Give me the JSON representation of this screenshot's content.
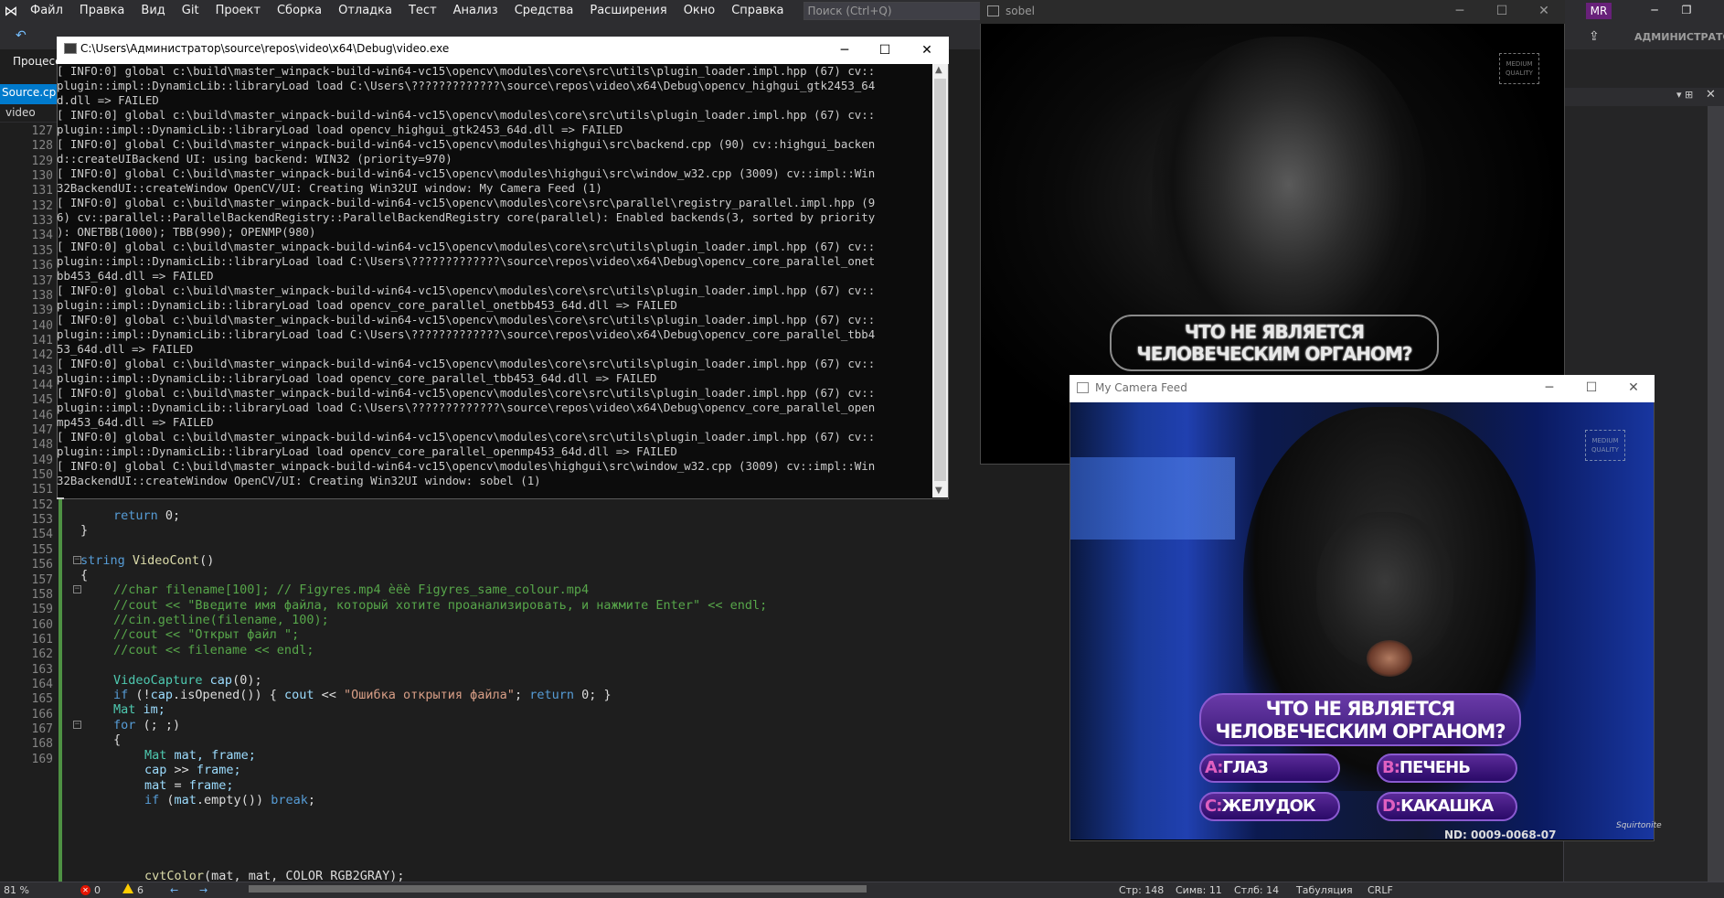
{
  "menubar": {
    "items": [
      "Файл",
      "Правка",
      "Вид",
      "Git",
      "Проект",
      "Сборка",
      "Отладка",
      "Тест",
      "Анализ",
      "Средства",
      "Расширения",
      "Окно",
      "Справка"
    ],
    "search_placeholder": "Поиск (Ctrl+Q)",
    "solution_name": "video",
    "user_initials": "MR",
    "admin_label": "АДМИНИСТРАТОР"
  },
  "toolbar": {
    "process_label": "Процесс"
  },
  "tabs": {
    "source_tab": "Source.cpp",
    "project_label": "video"
  },
  "editor": {
    "lines": [
      {
        "n": "127"
      },
      {
        "n": "128"
      },
      {
        "n": "129"
      },
      {
        "n": "130"
      },
      {
        "n": "131"
      },
      {
        "n": "132"
      },
      {
        "n": "133"
      },
      {
        "n": "134"
      },
      {
        "n": "135"
      },
      {
        "n": "136"
      },
      {
        "n": "137"
      },
      {
        "n": "138"
      },
      {
        "n": "139"
      },
      {
        "n": "140"
      },
      {
        "n": "141"
      },
      {
        "n": "142"
      },
      {
        "n": "143"
      },
      {
        "n": "144"
      },
      {
        "n": "145"
      },
      {
        "n": "146"
      },
      {
        "n": "147"
      },
      {
        "n": "148"
      },
      {
        "n": "149"
      },
      {
        "n": "150"
      },
      {
        "n": "151"
      },
      {
        "n": "152"
      },
      {
        "n": "153"
      },
      {
        "n": "154"
      },
      {
        "n": "155"
      },
      {
        "n": "156"
      },
      {
        "n": "157"
      },
      {
        "n": "158"
      },
      {
        "n": "159"
      },
      {
        "n": "160"
      },
      {
        "n": "161"
      },
      {
        "n": "162"
      },
      {
        "n": "163"
      },
      {
        "n": "164"
      },
      {
        "n": "165"
      },
      {
        "n": "166"
      },
      {
        "n": "167"
      },
      {
        "n": "168"
      },
      {
        "n": "169"
      }
    ],
    "code": {
      "l148_kw": "return",
      "l148_rest": " 0;",
      "l149": "}",
      "l151_type": "string",
      "l151_fn": " VideoCont",
      "l151_rest": "()",
      "l152": "{",
      "l153": "//char filename[100]; // Figyres.mp4 èëè Figyres_same_colour.mp4",
      "l154": "//cout << \"Введите имя файла, который хотите проанализировать, и нажмите Enter\" << endl;",
      "l155": "//cin.getline(filename, 100);",
      "l156": "//cout << \"Открыт файл \";",
      "l157": "//cout << filename << endl;",
      "l159_type": "VideoCapture",
      "l159_rest_a": " cap",
      "l159_rest_b": "(0);",
      "l160_kw": "if",
      "l160_a": " (!",
      "l160_b": "cap",
      "l160_c": ".isOpened()) { ",
      "l160_d": "cout",
      "l160_e": " << ",
      "l160_str": "\"Ошибка открытия файла\"",
      "l160_f": "; ",
      "l160_kw2": "return",
      "l160_g": " 0; }",
      "l161_type": "Mat",
      "l161_rest": " im;",
      "l162_kw": "for",
      "l162_rest": " (; ;)",
      "l163": "{",
      "l164_type": "Mat",
      "l164_rest": " mat, frame;",
      "l165_a": "cap",
      "l165_b": " >> ",
      "l165_c": "frame;",
      "l166_a": "mat",
      "l166_b": " = ",
      "l166_c": "frame;",
      "l167_kw": "if",
      "l167_a": " (",
      "l167_b": "mat",
      "l167_c": ".empty()) ",
      "l167_kw2": "break",
      "l167_d": ";",
      "l169_fn": "cvtColor",
      "l169_rest": "(mat, mat, COLOR_RGB2GRAY);"
    }
  },
  "statusbar": {
    "zoom": "81 %",
    "errors": "0",
    "warnings": "6",
    "row": "Стр: 148",
    "char": "Симв: 11",
    "col": "Стлб: 14",
    "tabs": "Табуляция",
    "eol": "CRLF"
  },
  "console": {
    "title": "C:\\Users\\Администратор\\source\\repos\\video\\x64\\Debug\\video.exe",
    "lines": [
      "[ INFO:0] global c:\\build\\master_winpack-build-win64-vc15\\opencv\\modules\\core\\src\\utils\\plugin_loader.impl.hpp (67) cv::",
      "plugin::impl::DynamicLib::libraryLoad load C:\\Users\\?????????????\\source\\repos\\video\\x64\\Debug\\opencv_highgui_gtk2453_64",
      "d.dll => FAILED",
      "[ INFO:0] global c:\\build\\master_winpack-build-win64-vc15\\opencv\\modules\\core\\src\\utils\\plugin_loader.impl.hpp (67) cv::",
      "plugin::impl::DynamicLib::libraryLoad load opencv_highgui_gtk2453_64d.dll => FAILED",
      "[ INFO:0] global C:\\build\\master_winpack-build-win64-vc15\\opencv\\modules\\highgui\\src\\backend.cpp (90) cv::highgui_backen",
      "d::createUIBackend UI: using backend: WIN32 (priority=970)",
      "[ INFO:0] global C:\\build\\master_winpack-build-win64-vc15\\opencv\\modules\\highgui\\src\\window_w32.cpp (3009) cv::impl::Win",
      "32BackendUI::createWindow OpenCV/UI: Creating Win32UI window: My Camera Feed (1)",
      "[ INFO:0] global c:\\build\\master_winpack-build-win64-vc15\\opencv\\modules\\core\\src\\parallel\\registry_parallel.impl.hpp (9",
      "6) cv::parallel::ParallelBackendRegistry::ParallelBackendRegistry core(parallel): Enabled backends(3, sorted by priority",
      "): ONETBB(1000); TBB(990); OPENMP(980)",
      "[ INFO:0] global c:\\build\\master_winpack-build-win64-vc15\\opencv\\modules\\core\\src\\utils\\plugin_loader.impl.hpp (67) cv::",
      "plugin::impl::DynamicLib::libraryLoad load C:\\Users\\?????????????\\source\\repos\\video\\x64\\Debug\\opencv_core_parallel_onet",
      "bb453_64d.dll => FAILED",
      "[ INFO:0] global c:\\build\\master_winpack-build-win64-vc15\\opencv\\modules\\core\\src\\utils\\plugin_loader.impl.hpp (67) cv::",
      "plugin::impl::DynamicLib::libraryLoad load opencv_core_parallel_onetbb453_64d.dll => FAILED",
      "[ INFO:0] global c:\\build\\master_winpack-build-win64-vc15\\opencv\\modules\\core\\src\\utils\\plugin_loader.impl.hpp (67) cv::",
      "plugin::impl::DynamicLib::libraryLoad load C:\\Users\\?????????????\\source\\repos\\video\\x64\\Debug\\opencv_core_parallel_tbb4",
      "53_64d.dll => FAILED",
      "[ INFO:0] global c:\\build\\master_winpack-build-win64-vc15\\opencv\\modules\\core\\src\\utils\\plugin_loader.impl.hpp (67) cv::",
      "plugin::impl::DynamicLib::libraryLoad load opencv_core_parallel_tbb453_64d.dll => FAILED",
      "[ INFO:0] global c:\\build\\master_winpack-build-win64-vc15\\opencv\\modules\\core\\src\\utils\\plugin_loader.impl.hpp (67) cv::",
      "plugin::impl::DynamicLib::libraryLoad load C:\\Users\\?????????????\\source\\repos\\video\\x64\\Debug\\opencv_core_parallel_open",
      "mp453_64d.dll => FAILED",
      "[ INFO:0] global c:\\build\\master_winpack-build-win64-vc15\\opencv\\modules\\core\\src\\utils\\plugin_loader.impl.hpp (67) cv::",
      "plugin::impl::DynamicLib::libraryLoad load opencv_core_parallel_openmp453_64d.dll => FAILED",
      "[ INFO:0] global C:\\build\\master_winpack-build-win64-vc15\\opencv\\modules\\highgui\\src\\window_w32.cpp (3009) cv::impl::Win",
      "32BackendUI::createWindow OpenCV/UI: Creating Win32UI window: sobel (1)"
    ]
  },
  "sobel_window": {
    "title": "sobel",
    "caption_line1": "ЧТО НЕ ЯВЛЯЕТСЯ",
    "caption_line2": "ЧЕЛОВЕЧЕСКИМ ОРГАНОМ?",
    "badge": "MEDIUM QUALITY"
  },
  "camera_window": {
    "title": "My Camera Feed",
    "question_line1": "ЧТО НЕ ЯВЛЯЕТСЯ",
    "question_line2": "ЧЕЛОВЕЧЕСКИМ ОРГАНОМ?",
    "answers": [
      {
        "letter": "A:",
        "text": "ГЛАЗ"
      },
      {
        "letter": "B:",
        "text": "ПЕЧЕНЬ"
      },
      {
        "letter": "C:",
        "text": "ЖЕЛУДОК"
      },
      {
        "letter": "D:",
        "text": "КАКАШКА"
      }
    ],
    "badge": "MEDIUM QUALITY",
    "watermark": "Squirtonite",
    "nd_code": "ND: 0009-0068-07"
  },
  "colors": {
    "vs_accent": "#007acc",
    "comment": "#57a64a",
    "keyword": "#569cd6",
    "type": "#4ec9b0",
    "string": "#d69d85",
    "quiz_purple": "#6a3aa8"
  }
}
